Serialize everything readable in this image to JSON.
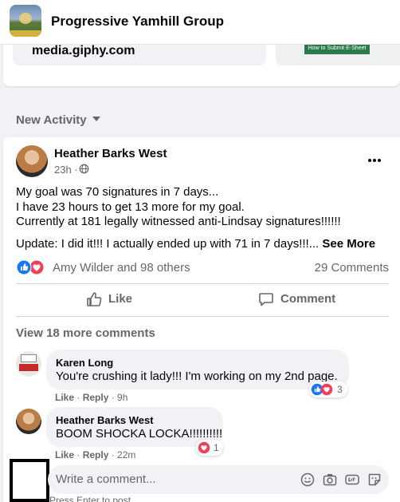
{
  "header": {
    "group_name": "Progressive Yamhill Group"
  },
  "pinned": {
    "link_domain": "media.giphy.com",
    "promo_button_label": "How to Submit E-Sheet"
  },
  "activity": {
    "label": "New Activity"
  },
  "post": {
    "author": "Heather Barks West",
    "time": "23h ·",
    "body_lines": [
      "My goal was 70 signatures in 7 days...",
      "I have 23 hours to get 13 more for my goal.",
      "Currently at 181 legally witnessed anti-Lindsay signatures!!!!!!"
    ],
    "update_text": "Update:  I did it!!!  I actually ended up with 71 in 7 days!!!...",
    "see_more": "See More",
    "reactions_text": "Amy Wilder and 98 others",
    "comments_count": "29 Comments",
    "like_label": "Like",
    "comment_label": "Comment",
    "view_more": "View 18 more comments"
  },
  "comments": [
    {
      "author": "Karen Long",
      "text": "You're crushing it lady!!! I'm working on my 2nd page.",
      "like": "Like",
      "reply": "Reply",
      "time": "9h",
      "reaction_count": "3"
    },
    {
      "author": "Heather Barks West",
      "text": "BOOM SHOCKA LOCKA!!!!!!!!!!",
      "like": "Like",
      "reply": "Reply",
      "time": "22m",
      "reaction_count": "1"
    }
  ],
  "composer": {
    "placeholder": "Write a comment...",
    "hint": "Press Enter to post."
  },
  "colors": {
    "like_blue": "#1877f2",
    "love_red": "#f33e58",
    "secondary_text": "#65676b",
    "background": "#f0f2f5"
  }
}
